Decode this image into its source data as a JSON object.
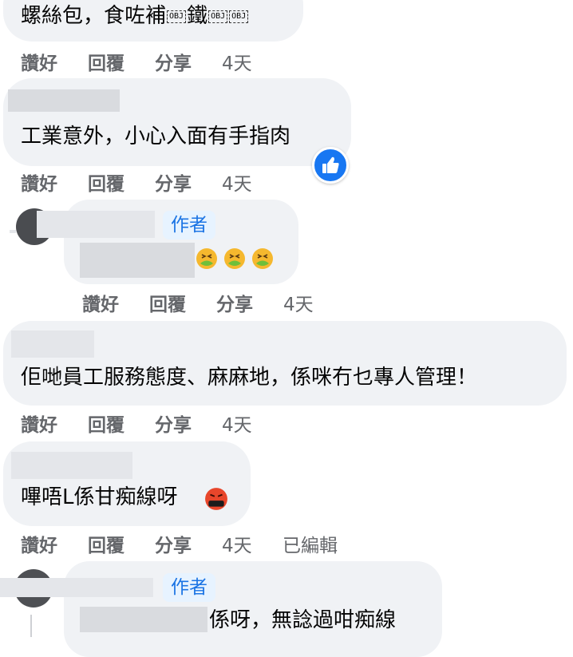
{
  "actions": {
    "like": "讚好",
    "reply": "回覆",
    "share": "分享"
  },
  "comments": [
    {
      "text": "螺絲包，食咗補",
      "text_after_obj": "鐵",
      "obj_tag": "OBJ",
      "time": "4天"
    },
    {
      "text": "工業意外，小心入面有手指肉",
      "time": "4天"
    },
    {
      "author_badge": "作者",
      "time": "4天"
    },
    {
      "text": "佢哋員工服務態度、麻麻地，係咪冇乜專人管理！",
      "time": "4天"
    },
    {
      "text": "嗶唔L係甘痴線呀",
      "time": "4天",
      "edited": "已編輯"
    },
    {
      "author_badge": "作者",
      "text": "係呀，無諗過咁痴線"
    }
  ],
  "colors": {
    "bubble": "#f0f2f5",
    "action_text": "#65676b",
    "badge_bg": "#e7f3ff",
    "badge_text": "#1b74e4",
    "like_blue": "#1877f2"
  },
  "icons": {
    "like_reaction": "thumbs-up-icon",
    "nauseated_emoji": "nauseated-face-emoji",
    "cursing_emoji": "cursing-face-emoji"
  }
}
